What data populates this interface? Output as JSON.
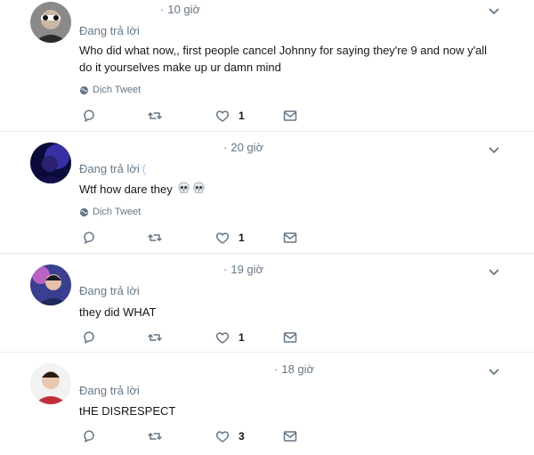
{
  "tweets": [
    {
      "time": "10 giờ",
      "reply_label": "Đang trả lời",
      "reply_handle": "",
      "text_lines": [
        "Who did what now,, first people cancel Johnny for saying they're 9 and now y'all",
        "do it yourselves make up ur damn mind"
      ],
      "translate": "Dịch Tweet",
      "likes": "1",
      "avatar_colors": [
        "#2a2a2a",
        "#c9b8a5"
      ]
    },
    {
      "time": "20 giờ",
      "reply_label": "Đang trả lời",
      "reply_handle": "(",
      "text": "Wtf how dare they",
      "emoji_count": 2,
      "translate": "Dịch Tweet",
      "likes": "1",
      "avatar_colors": [
        "#0b0b3a",
        "#4a3fd0"
      ]
    },
    {
      "time": "19 giờ",
      "reply_label": "Đang trả lời",
      "reply_handle": "",
      "text": "they did WHAT",
      "likes": "1",
      "avatar_colors": [
        "#3a3f8f",
        "#d86bd0"
      ]
    },
    {
      "time": "18 giờ",
      "reply_label": "Đang trả lời",
      "reply_handle": "",
      "text": "tHE DISRESPECT",
      "likes": "3",
      "avatar_colors": [
        "#f2f2f2",
        "#c0303a"
      ]
    }
  ],
  "colors": {
    "icon": "#657786",
    "divider": "#e6ecf0",
    "text": "#14171a",
    "muted": "#657786"
  }
}
